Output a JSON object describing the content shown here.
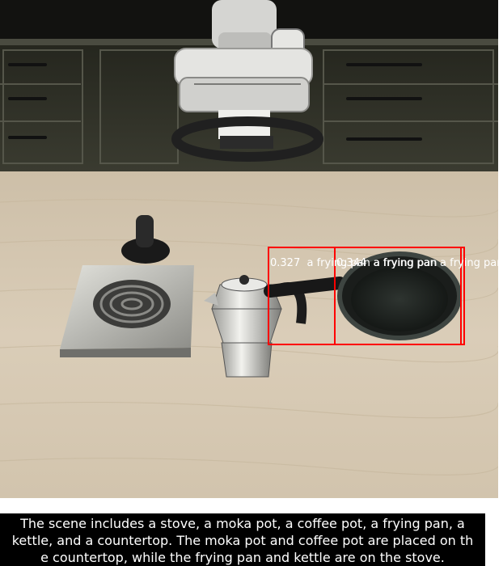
{
  "detections": [
    {
      "score": "0.327",
      "label": "a frying pan a frying pan",
      "box_color": "#ff0000"
    },
    {
      "score": "0.344",
      "label": "a frying pan a frying pan",
      "box_color": "#ff0000"
    }
  ],
  "caption": {
    "line1": "The scene includes a stove, a moka pot, a coffee pot, a frying pan, a",
    "line2": "kettle, and a countertop. The moka pot and coffee pot are placed on th",
    "line3": "e countertop, while the frying pan and kettle are on the stove."
  },
  "colors": {
    "countertop": "#d8cbb4",
    "cabinet": "#2c2d24",
    "caption_background": "#000000",
    "caption_text": "#ffffff"
  }
}
